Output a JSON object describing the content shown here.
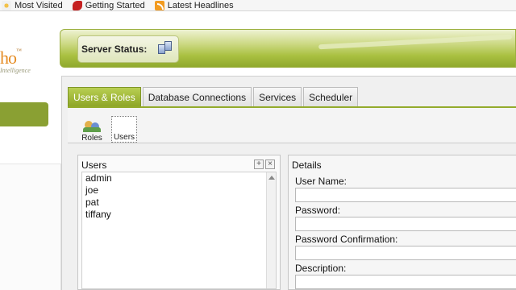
{
  "bookmarks": [
    {
      "label": "Most Visited",
      "icon": "star-icon"
    },
    {
      "label": "Getting Started",
      "icon": "firefox-icon"
    },
    {
      "label": "Latest Headlines",
      "icon": "rss-icon"
    }
  ],
  "brand": {
    "logo_text": "ho",
    "logo_tm": "™",
    "logo_sub": "Intelligence"
  },
  "header": {
    "server_status_label": "Server Status:"
  },
  "tabs": [
    {
      "label": "Users & Roles",
      "active": true
    },
    {
      "label": "Database Connections",
      "active": false
    },
    {
      "label": "Services",
      "active": false
    },
    {
      "label": "Scheduler",
      "active": false
    }
  ],
  "toolbar": {
    "roles_label": "Roles",
    "users_label": "Users"
  },
  "users": {
    "title": "Users",
    "add_symbol": "+",
    "remove_symbol": "×",
    "items": [
      "admin",
      "joe",
      "pat",
      "tiffany"
    ]
  },
  "details": {
    "title": "Details",
    "username_label": "User Name:",
    "password_label": "Password:",
    "password_confirm_label": "Password Confirmation:",
    "description_label": "Description:"
  },
  "colors": {
    "accent_green": "#8ea628",
    "brand_orange": "#e58b22"
  }
}
